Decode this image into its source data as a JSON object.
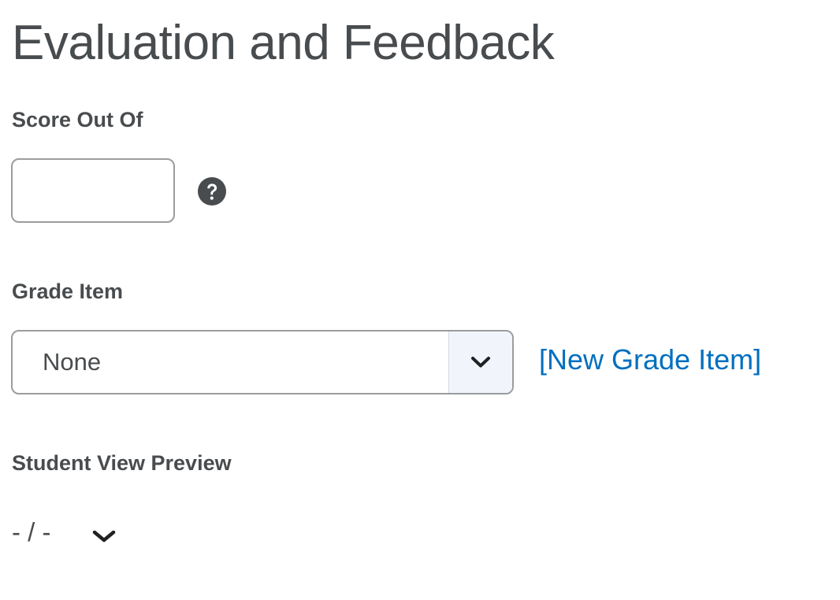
{
  "page": {
    "title": "Evaluation and Feedback"
  },
  "score_out_of": {
    "label": "Score Out Of",
    "value": "",
    "help_icon": "question-circle-icon"
  },
  "grade_item": {
    "label": "Grade Item",
    "selected": "None",
    "toggle_icon": "chevron-down-icon",
    "new_link": "[New Grade Item]",
    "link_color": "#006fbf"
  },
  "student_view_preview": {
    "label": "Student View Preview",
    "value": "- / -",
    "toggle_icon": "chevron-down-icon"
  }
}
